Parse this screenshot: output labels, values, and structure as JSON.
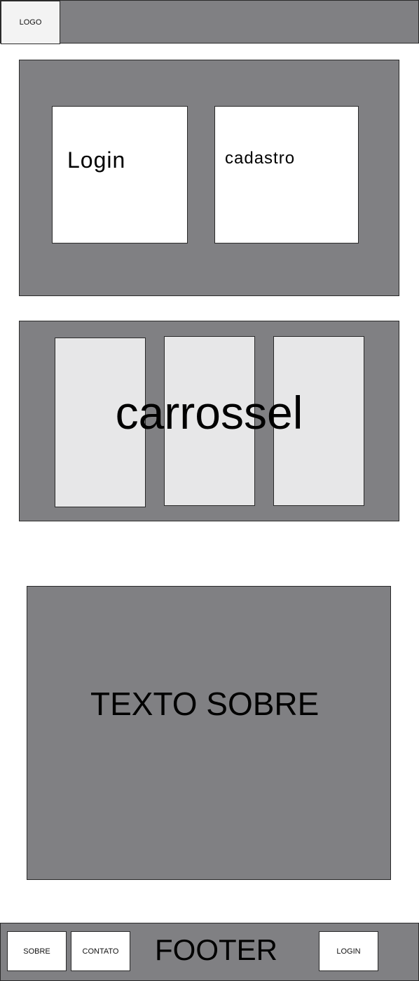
{
  "header": {
    "logo": "LOGO"
  },
  "auth": {
    "login_label": "Login",
    "cadastro_label": "cadastro"
  },
  "carousel": {
    "label": "carrossel"
  },
  "about": {
    "label": "TEXTO SOBRE"
  },
  "footer": {
    "label": "FOOTER",
    "sobre": "SOBRE",
    "contato": "CONTATO",
    "login": "LOGIN"
  }
}
